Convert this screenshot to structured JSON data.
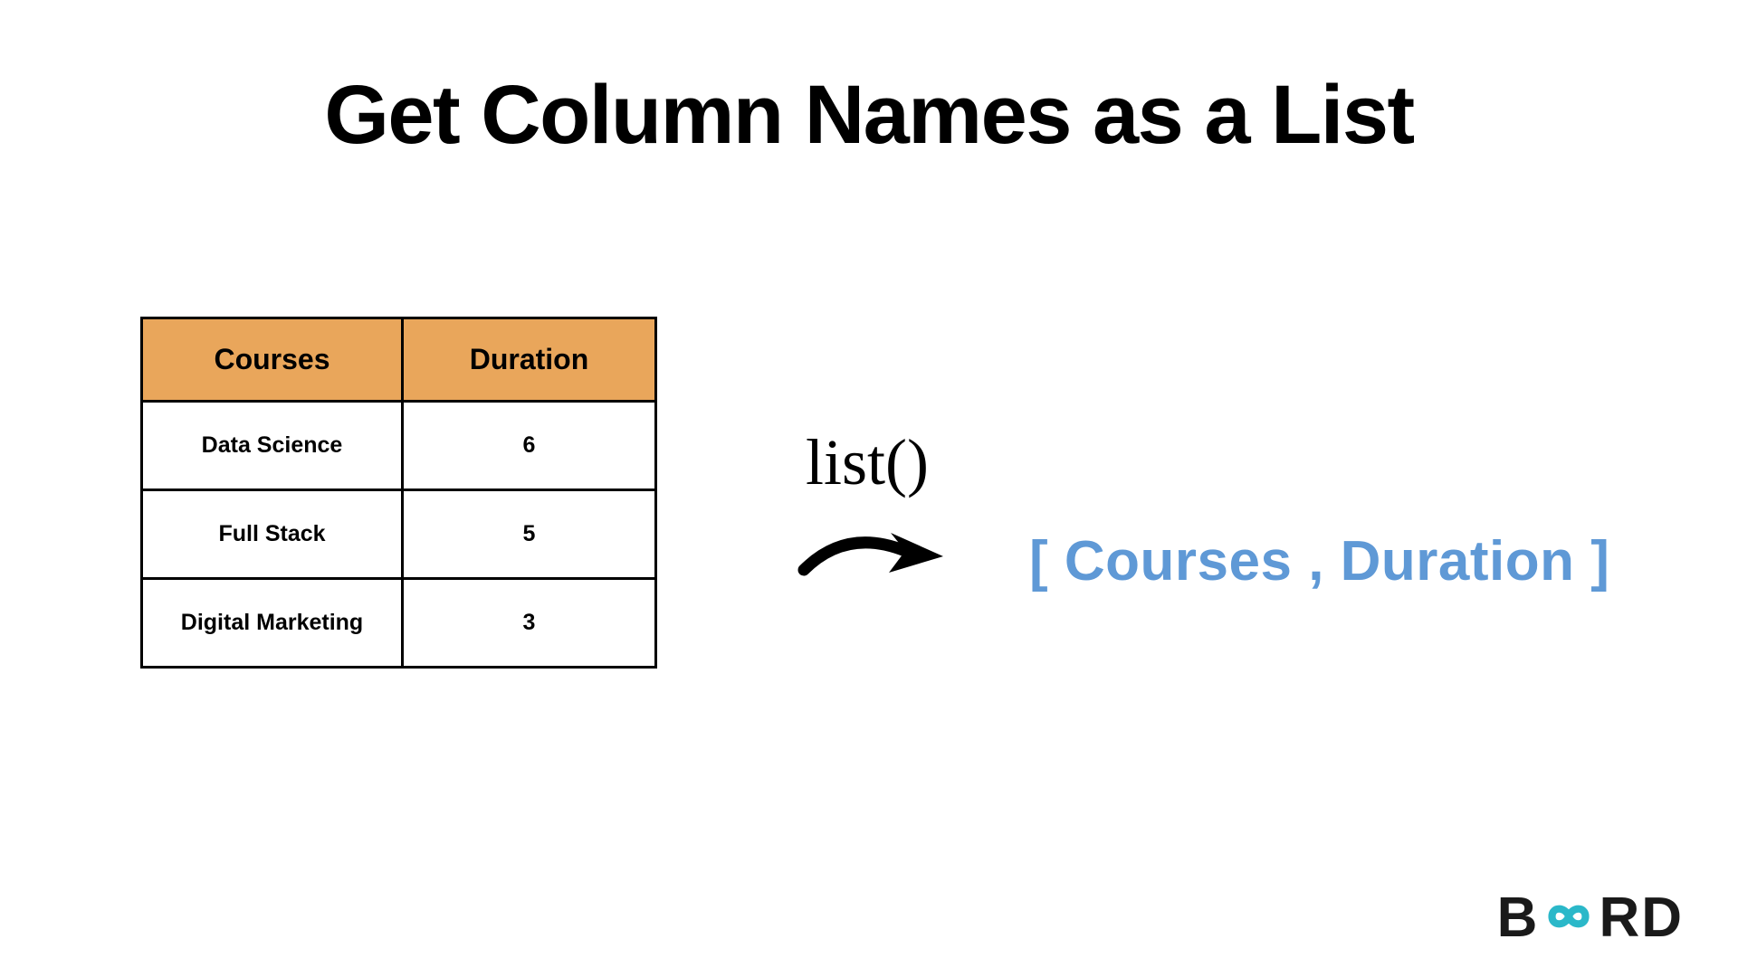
{
  "title": "Get Column Names as a List",
  "table": {
    "headers": [
      "Courses",
      "Duration"
    ],
    "rows": [
      {
        "course": "Data Science",
        "duration": "6"
      },
      {
        "course": "Full Stack",
        "duration": "5"
      },
      {
        "course": "Digital Marketing",
        "duration": "3"
      }
    ]
  },
  "function_label": "list()",
  "output": "[ Courses , Duration ]",
  "logo": {
    "left": "B",
    "right": "RD"
  },
  "chart_data": {
    "type": "table",
    "title": "Get Column Names as a List",
    "columns": [
      "Courses",
      "Duration"
    ],
    "rows": [
      [
        "Data Science",
        6
      ],
      [
        "Full Stack",
        5
      ],
      [
        "Digital Marketing",
        3
      ]
    ],
    "operation": "list()",
    "result": [
      "Courses",
      "Duration"
    ]
  }
}
